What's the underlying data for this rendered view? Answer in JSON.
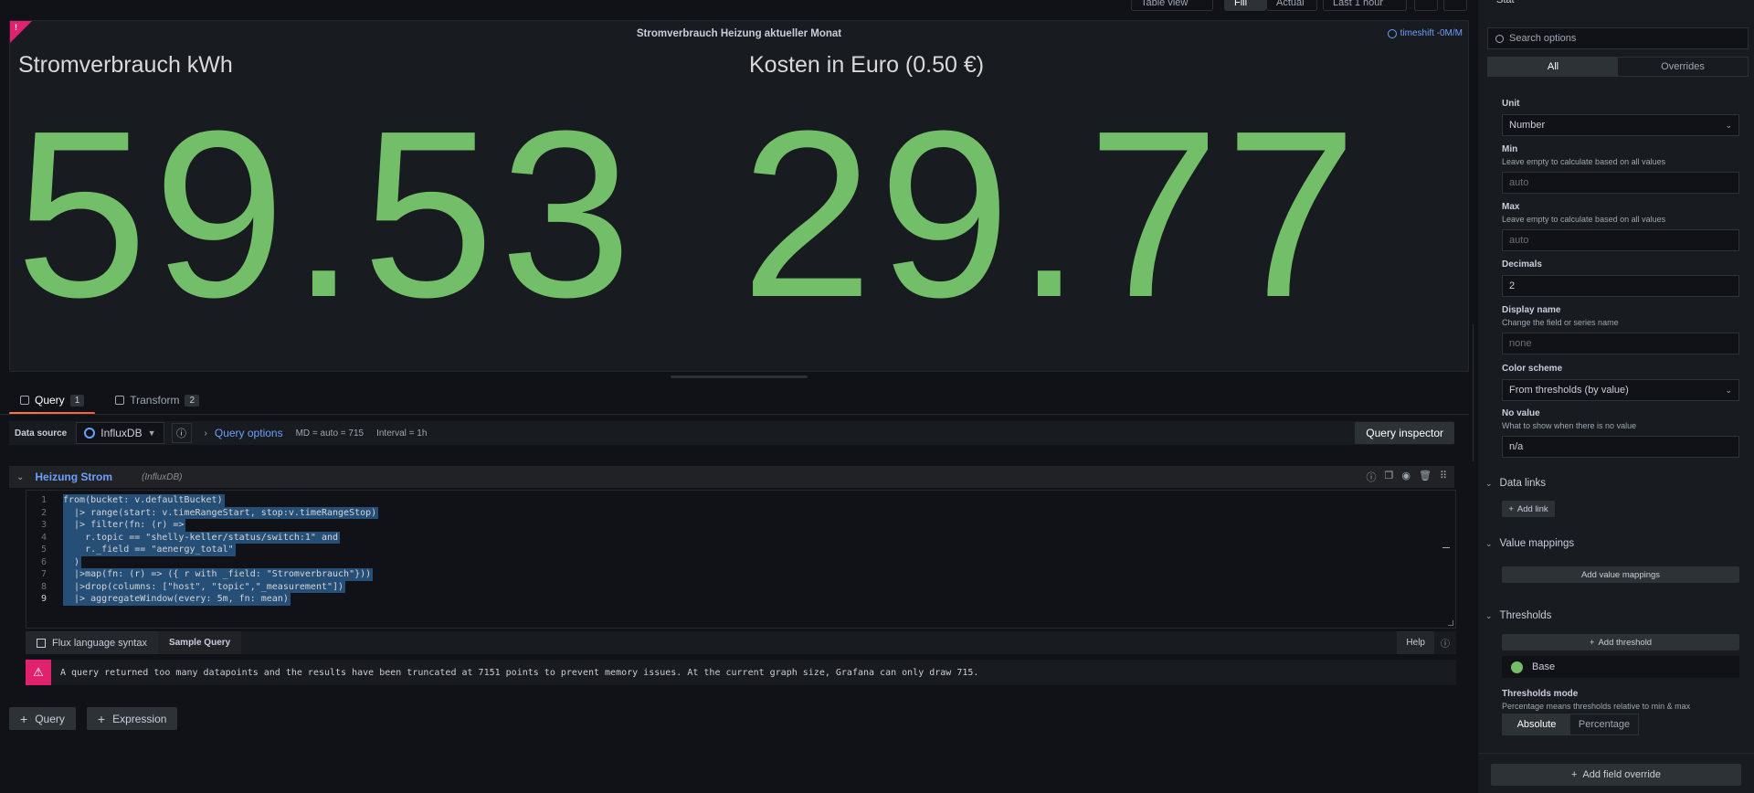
{
  "toolbar": {
    "table_view": "Table view",
    "fill": "Fill",
    "actual": "Actual",
    "time_range": "Last 1 hour",
    "viz_type": "Stat"
  },
  "panel": {
    "title": "Stromverbrauch Heizung aktueller Monat",
    "timeshift": "timeshift -0M/M",
    "corner_mark": "!",
    "stats": [
      {
        "label": "Stromverbrauch kWh",
        "value": "59.53"
      },
      {
        "label": "Kosten in Euro (0.50 €)",
        "value": "29.77"
      }
    ]
  },
  "tabs": {
    "query": {
      "label": "Query",
      "count": "1"
    },
    "transform": {
      "label": "Transform",
      "count": "2"
    }
  },
  "datasource": {
    "label": "Data source",
    "name": "InfluxDB",
    "query_options_label": "Query options",
    "md": "MD = auto = 715",
    "interval": "Interval = 1h",
    "inspector": "Query inspector"
  },
  "query_row": {
    "name": "Heizung Strom",
    "ds": "(InfluxDB)",
    "lines": [
      "from(bucket: v.defaultBucket)",
      "  |> range(start: v.timeRangeStart, stop:v.timeRangeStop)",
      "  |> filter(fn: (r) =>",
      "    r.topic == \"shelly-keller/status/switch:1\" and",
      "    r._field == \"aenergy_total\"",
      "  )",
      "  |>map(fn: (r) => ({ r with _field: \"Stromverbrauch\"}))",
      "  |>drop(columns: [\"host\", \"topic\",\"_measurement\"])",
      "  |> aggregateWindow(every: 5m, fn: mean)"
    ]
  },
  "help_bar": {
    "flux_syntax": "Flux language syntax",
    "sample_query": "Sample Query",
    "help": "Help"
  },
  "alert": {
    "text": "A query returned too many datapoints and the results have been truncated at 7151 points to prevent memory issues. At the current graph size, Grafana can only draw 715."
  },
  "add_buttons": {
    "query": "Query",
    "expression": "Expression"
  },
  "options": {
    "search_placeholder": "Search options",
    "seg_all": "All",
    "seg_overrides": "Overrides",
    "unit": {
      "label": "Unit",
      "value": "Number"
    },
    "min": {
      "label": "Min",
      "desc": "Leave empty to calculate based on all values",
      "placeholder": "auto"
    },
    "max": {
      "label": "Max",
      "desc": "Leave empty to calculate based on all values",
      "placeholder": "auto"
    },
    "decimals": {
      "label": "Decimals",
      "value": "2"
    },
    "display_name": {
      "label": "Display name",
      "desc": "Change the field or series name",
      "placeholder": "none"
    },
    "color_scheme": {
      "label": "Color scheme",
      "value": "From thresholds (by value)"
    },
    "no_value": {
      "label": "No value",
      "desc": "What to show when there is no value",
      "value": "n/a"
    },
    "data_links": {
      "title": "Data links",
      "button": "Add link"
    },
    "value_mappings": {
      "title": "Value mappings",
      "button": "Add value mappings"
    },
    "thresholds": {
      "title": "Thresholds",
      "button": "Add threshold",
      "base": "Base",
      "mode_label": "Thresholds mode",
      "mode_desc": "Percentage means thresholds relative to min & max",
      "absolute": "Absolute",
      "percentage": "Percentage"
    },
    "add_override": "Add field override"
  },
  "colors": {
    "stat_green": "#73bf69",
    "accent_blue": "#6e9fff",
    "error_pink": "#e0226e",
    "tab_orange": "#ff7941"
  }
}
